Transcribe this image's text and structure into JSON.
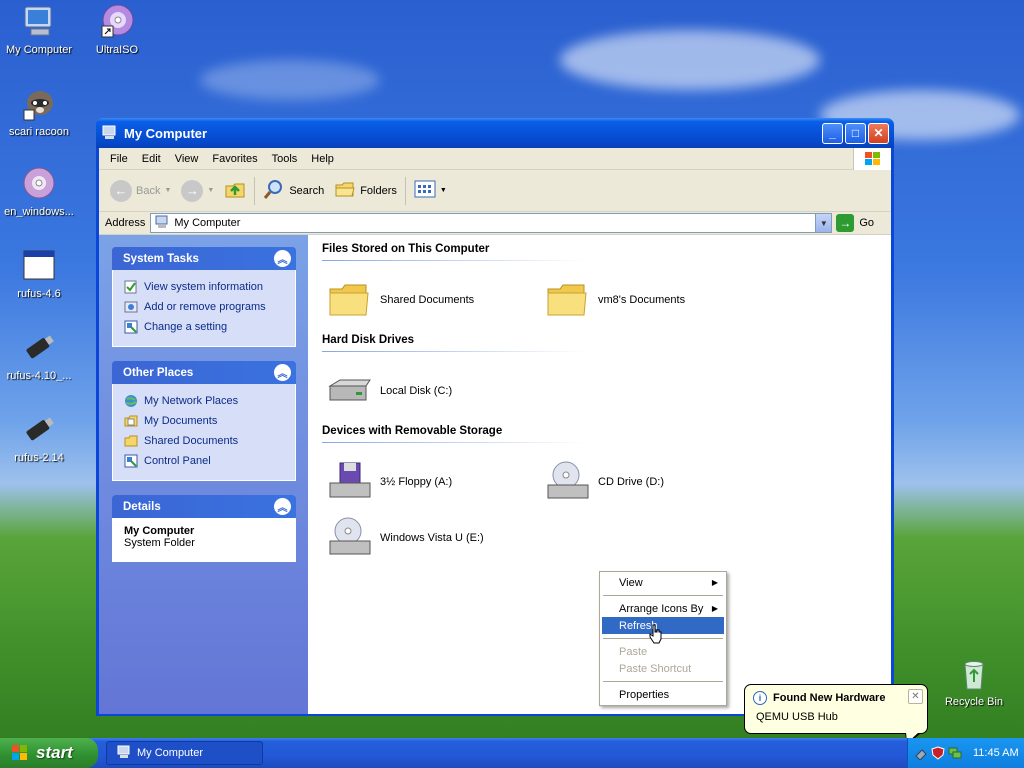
{
  "desktop": {
    "icons": [
      {
        "label": "My Computer",
        "icon": "my-computer-icon"
      },
      {
        "label": "UltraISO",
        "icon": "disc-shortcut-icon"
      },
      {
        "label": "scari racoon",
        "icon": "raccoon-shortcut-icon"
      },
      {
        "label": "en_windows...",
        "icon": "disc-icon"
      },
      {
        "label": "rufus-4.6",
        "icon": "app-window-icon"
      },
      {
        "label": "rufus-4.10_...",
        "icon": "usb-drive-icon"
      },
      {
        "label": "rufus-2.14",
        "icon": "usb-drive-icon"
      },
      {
        "label": "Recycle Bin",
        "icon": "recycle-bin-icon"
      }
    ]
  },
  "window": {
    "title": "My Computer",
    "menu": [
      "File",
      "Edit",
      "View",
      "Favorites",
      "Tools",
      "Help"
    ],
    "toolbar": {
      "back": "Back",
      "search": "Search",
      "folders": "Folders"
    },
    "address": {
      "label": "Address",
      "value": "My Computer",
      "go": "Go"
    }
  },
  "sidebar": {
    "system_tasks": {
      "title": "System Tasks",
      "items": [
        "View system information",
        "Add or remove programs",
        "Change a setting"
      ]
    },
    "other_places": {
      "title": "Other Places",
      "items": [
        "My Network Places",
        "My Documents",
        "Shared Documents",
        "Control Panel"
      ]
    },
    "details": {
      "title": "Details",
      "name": "My Computer",
      "type": "System Folder"
    }
  },
  "content": {
    "sections": [
      {
        "title": "Files Stored on This Computer",
        "items": [
          "Shared Documents",
          "vm8's Documents"
        ]
      },
      {
        "title": "Hard Disk Drives",
        "items": [
          "Local Disk (C:)"
        ]
      },
      {
        "title": "Devices with Removable Storage",
        "items": [
          "3½ Floppy (A:)",
          "CD Drive (D:)",
          "Windows Vista U (E:)"
        ]
      }
    ]
  },
  "context_menu": {
    "view": "View",
    "arrange": "Arrange Icons By",
    "refresh": "Refresh",
    "paste": "Paste",
    "paste_shortcut": "Paste Shortcut",
    "properties": "Properties",
    "selected": "Refresh"
  },
  "taskbar": {
    "start": "start",
    "task": "My Computer",
    "clock": "11:45 AM"
  },
  "balloon": {
    "title": "Found New Hardware",
    "message": "QEMU USB Hub"
  },
  "colors": {
    "titlebar": "#0752d8",
    "selection": "#316ac5",
    "sidebar_link": "#0c2b8a",
    "taskbar": "#245edb",
    "start_button": "#2f8f2f"
  }
}
